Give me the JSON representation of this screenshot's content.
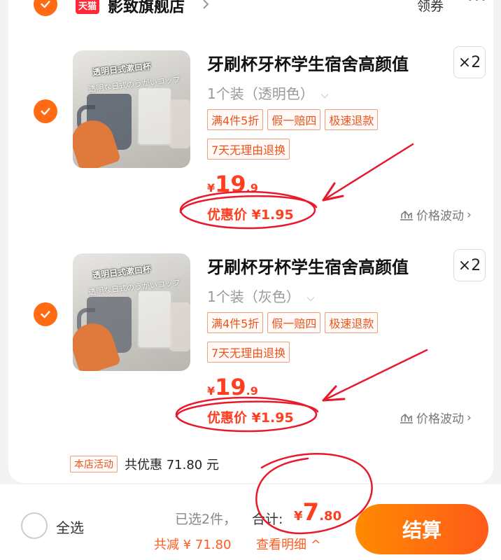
{
  "shop": {
    "logo_text": "天猫",
    "name": "影致旗舰店",
    "coupon_label": "领券",
    "more_label": "···"
  },
  "items": [
    {
      "image_caption_1": "透明日式漱口杯",
      "image_caption_2": "透明な日式のうがいコップ",
      "title": "牙刷杯牙杯学生宿舍高颜值",
      "quantity": "×2",
      "spec": "1个装（透明色）",
      "tags": [
        "满4件5折",
        "假一赔四",
        "极速退款",
        "7天无理由退换"
      ],
      "price_yen": "¥",
      "price_int": "19",
      "price_dec": ".9",
      "deal_price": "优惠价 ¥1.95",
      "fluct_label": "价格波动"
    },
    {
      "image_caption_1": "透明日式漱口杯",
      "image_caption_2": "透明な日式のうがいコップ",
      "title": "牙刷杯牙杯学生宿舍高颜值",
      "quantity": "×2",
      "spec": "1个装（灰色）",
      "tags": [
        "满4件5折",
        "假一赔四",
        "极速退款",
        "7天无理由退换"
      ],
      "price_yen": "¥",
      "price_int": "19",
      "price_dec": ".9",
      "deal_price": "优惠价 ¥1.95",
      "fluct_label": "价格波动"
    }
  ],
  "shop_promo": {
    "tag": "本店活动",
    "text": "共优惠 71.80 元"
  },
  "footer": {
    "select_all": "全选",
    "selected_count": "已选2件，",
    "total_label": "合计:",
    "total_yen": "¥",
    "total_int": "7",
    "total_dec": ".80",
    "discount": "共减 ¥ 71.80",
    "detail": "查看明细 ^",
    "checkout": "结算"
  },
  "colors": {
    "accent": "#ff6a13",
    "price": "#ff3d1f",
    "annotation": "#e8192c"
  }
}
